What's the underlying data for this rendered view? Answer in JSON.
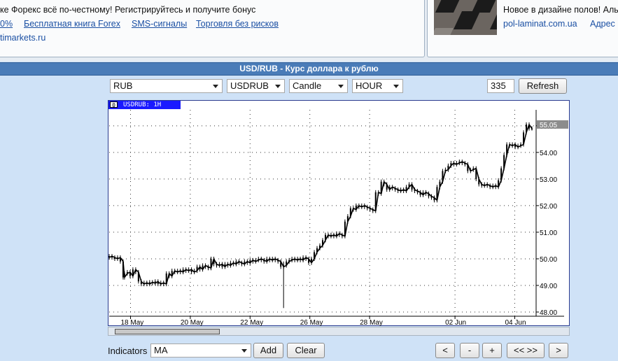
{
  "ads": {
    "left_line1": "ке Форекс всё по-честному! Регистрируйтесь и получите бонус",
    "left_links": [
      "0%",
      "Бесплатная книга Forex",
      "SMS-сигналы",
      "Торговля без рисков"
    ],
    "left_domain": "timarkets.ru",
    "right_title": "Новое в дизайне полов! Аль",
    "right_domain": "pol-laminat.com.ua",
    "right_link": "Адрес"
  },
  "section_title": "USD/RUB - Курс доллара к рублю",
  "controls": {
    "currency": "RUB",
    "symbol": "USDRUB",
    "chart_type": "Candle",
    "period": "HOUR",
    "bars_count": "335",
    "refresh_label": "Refresh"
  },
  "chart_tab": {
    "number": "0",
    "name": "USDRUB: 1H"
  },
  "bottom": {
    "indicators_label": "Indicators",
    "indicator_value": "MA",
    "add_label": "Add",
    "clear_label": "Clear",
    "nav_buttons": [
      "<",
      "-",
      "+",
      "<< >>",
      ">"
    ]
  },
  "chart_data": {
    "type": "candlestick",
    "symbol": "USDRUB",
    "timeframe": "1H",
    "last_value": "55.05",
    "ylim": [
      48.0,
      55.6
    ],
    "y_ticks": [
      "48.00",
      "49.00",
      "50.00",
      "51.00",
      "52.00",
      "53.00",
      "54.00",
      "55.00"
    ],
    "x_ticks": [
      "18 May",
      "20 May",
      "22 May",
      "26 May",
      "28 May",
      "02 Jun",
      "04 Jun"
    ],
    "grid": true,
    "series": [
      {
        "name": "USDRUB",
        "points": [
          [
            0,
            50.05
          ],
          [
            4,
            50.1
          ],
          [
            8,
            50.05
          ],
          [
            12,
            50.0
          ],
          [
            16,
            50.05
          ],
          [
            20,
            49.9
          ],
          [
            22,
            49.3
          ],
          [
            26,
            49.45
          ],
          [
            30,
            49.5
          ],
          [
            34,
            49.35
          ],
          [
            38,
            49.6
          ],
          [
            42,
            49.5
          ],
          [
            46,
            49.15
          ],
          [
            50,
            49.05
          ],
          [
            54,
            49.1
          ],
          [
            58,
            49.05
          ],
          [
            62,
            49.12
          ],
          [
            66,
            49.08
          ],
          [
            70,
            49.15
          ],
          [
            74,
            49.05
          ],
          [
            78,
            49.1
          ],
          [
            82,
            49.05
          ],
          [
            86,
            49.45
          ],
          [
            90,
            49.35
          ],
          [
            94,
            49.55
          ],
          [
            98,
            49.5
          ],
          [
            102,
            49.55
          ],
          [
            106,
            49.5
          ],
          [
            110,
            49.6
          ],
          [
            114,
            49.55
          ],
          [
            118,
            49.6
          ],
          [
            122,
            49.5
          ],
          [
            126,
            49.55
          ],
          [
            130,
            49.7
          ],
          [
            134,
            49.6
          ],
          [
            138,
            49.75
          ],
          [
            142,
            49.7
          ],
          [
            146,
            49.65
          ],
          [
            150,
            50.0
          ],
          [
            154,
            49.8
          ],
          [
            158,
            49.75
          ],
          [
            162,
            49.8
          ],
          [
            166,
            49.7
          ],
          [
            170,
            49.8
          ],
          [
            174,
            49.75
          ],
          [
            178,
            49.85
          ],
          [
            182,
            49.8
          ],
          [
            186,
            49.9
          ],
          [
            190,
            49.85
          ],
          [
            194,
            49.8
          ],
          [
            198,
            49.9
          ],
          [
            202,
            49.85
          ],
          [
            206,
            49.95
          ],
          [
            210,
            49.9
          ],
          [
            214,
            49.95
          ],
          [
            218,
            50.0
          ],
          [
            222,
            49.95
          ],
          [
            226,
            49.9
          ],
          [
            230,
            50.0
          ],
          [
            234,
            49.95
          ],
          [
            238,
            50.0
          ],
          [
            242,
            49.95
          ],
          [
            246,
            49.9
          ],
          [
            250,
            49.7
          ],
          [
            254,
            49.75
          ],
          [
            258,
            49.9
          ],
          [
            262,
            49.95
          ],
          [
            266,
            50.0
          ],
          [
            270,
            49.95
          ],
          [
            274,
            50.0
          ],
          [
            278,
            49.95
          ],
          [
            282,
            50.05
          ],
          [
            286,
            50.0
          ],
          [
            290,
            49.85
          ],
          [
            294,
            50.0
          ],
          [
            298,
            50.25
          ],
          [
            302,
            50.4
          ],
          [
            306,
            50.5
          ],
          [
            310,
            50.7
          ],
          [
            314,
            50.9
          ],
          [
            318,
            50.85
          ],
          [
            322,
            50.9
          ],
          [
            326,
            50.85
          ],
          [
            330,
            50.95
          ],
          [
            334,
            50.9
          ],
          [
            338,
            50.85
          ],
          [
            342,
            51.4
          ],
          [
            346,
            51.6
          ],
          [
            350,
            51.9
          ],
          [
            354,
            51.85
          ],
          [
            358,
            52.0
          ],
          [
            362,
            51.95
          ],
          [
            366,
            52.0
          ],
          [
            370,
            51.95
          ],
          [
            374,
            51.9
          ],
          [
            378,
            51.85
          ],
          [
            382,
            51.8
          ],
          [
            386,
            52.5
          ],
          [
            390,
            52.45
          ],
          [
            394,
            52.9
          ],
          [
            398,
            52.8
          ],
          [
            402,
            52.6
          ],
          [
            406,
            52.7
          ],
          [
            410,
            52.65
          ],
          [
            414,
            52.6
          ],
          [
            418,
            52.55
          ],
          [
            422,
            52.6
          ],
          [
            426,
            52.55
          ],
          [
            430,
            52.7
          ],
          [
            434,
            52.8
          ],
          [
            438,
            52.6
          ],
          [
            442,
            52.55
          ],
          [
            446,
            52.5
          ],
          [
            450,
            52.4
          ],
          [
            454,
            52.5
          ],
          [
            458,
            52.45
          ],
          [
            462,
            52.35
          ],
          [
            466,
            52.3
          ],
          [
            470,
            52.2
          ],
          [
            474,
            52.7
          ],
          [
            478,
            52.9
          ],
          [
            482,
            53.3
          ],
          [
            486,
            53.35
          ],
          [
            490,
            53.5
          ],
          [
            494,
            53.6
          ],
          [
            498,
            53.55
          ],
          [
            502,
            53.6
          ],
          [
            506,
            53.65
          ],
          [
            510,
            53.6
          ],
          [
            514,
            53.55
          ],
          [
            518,
            53.3
          ],
          [
            522,
            53.35
          ],
          [
            526,
            53.4
          ],
          [
            530,
            53.0
          ],
          [
            534,
            52.8
          ],
          [
            538,
            52.75
          ],
          [
            542,
            52.8
          ],
          [
            546,
            52.75
          ],
          [
            550,
            52.7
          ],
          [
            554,
            52.75
          ],
          [
            558,
            52.7
          ],
          [
            562,
            52.95
          ],
          [
            566,
            53.4
          ],
          [
            570,
            53.9
          ],
          [
            574,
            54.3
          ],
          [
            578,
            54.25
          ],
          [
            582,
            54.3
          ],
          [
            586,
            54.2
          ],
          [
            590,
            54.25
          ],
          [
            594,
            54.3
          ],
          [
            598,
            54.75
          ],
          [
            602,
            55.05
          ],
          [
            606,
            54.9
          ]
        ]
      }
    ]
  }
}
